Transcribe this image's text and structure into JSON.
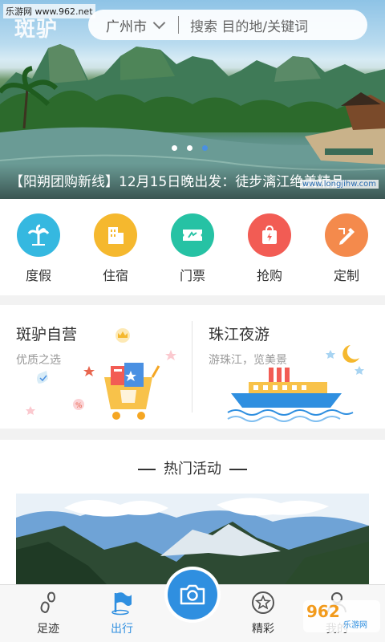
{
  "watermark": "乐游网 www.962.net",
  "header": {
    "logo": "斑驴",
    "city": "广州市",
    "search_placeholder": "搜索 目的地/关键词"
  },
  "banner": {
    "caption": "【阳朔团购新线】12月15日晚出发：徒步漓江绝美精品线路",
    "brand": "www.longjihw.com",
    "slide_count": 3,
    "active_slide": 3
  },
  "categories": [
    {
      "label": "度假",
      "icon": "palm-tree-icon",
      "color": "#35b8e0"
    },
    {
      "label": "住宿",
      "icon": "building-icon",
      "color": "#f5b82e"
    },
    {
      "label": "门票",
      "icon": "ticket-icon",
      "color": "#26c2a4"
    },
    {
      "label": "抢购",
      "icon": "flash-bag-icon",
      "color": "#f25c54"
    },
    {
      "label": "定制",
      "icon": "pencil-ruler-icon",
      "color": "#f48a4c"
    }
  ],
  "promos": [
    {
      "title": "斑驴自营",
      "subtitle": "优质之选"
    },
    {
      "title": "珠江夜游",
      "subtitle": "游珠江，览美景"
    }
  ],
  "hot": {
    "title": "热门活动"
  },
  "tabbar": {
    "items": [
      {
        "label": "足迹",
        "icon": "footprint-icon",
        "active": false
      },
      {
        "label": "出行",
        "icon": "flag-icon",
        "active": true
      },
      {
        "label": "",
        "icon": "camera-icon",
        "active": false
      },
      {
        "label": "精彩",
        "icon": "star-icon",
        "active": false
      },
      {
        "label": "我的",
        "icon": "user-icon",
        "active": false
      }
    ]
  },
  "corner_watermark": {
    "big": "962",
    "small": "乐游网"
  },
  "colors": {
    "accent": "#2f8fe0",
    "background": "#f2f2f2"
  }
}
